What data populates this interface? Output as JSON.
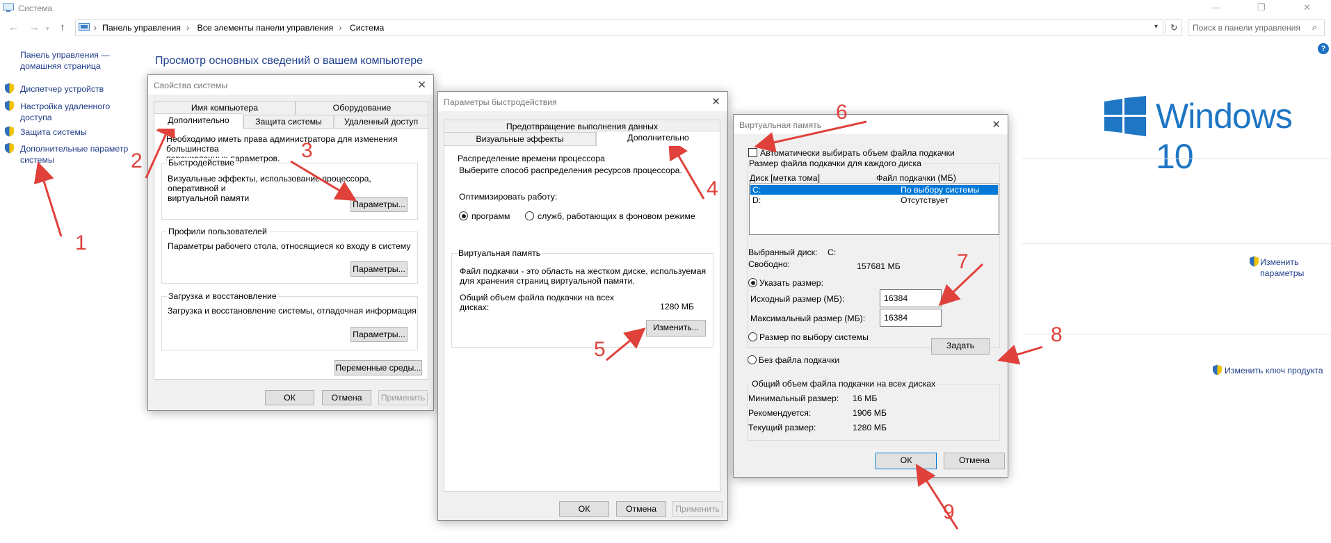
{
  "window": {
    "title": "Система",
    "minimize_glyph": "—",
    "restore_glyph": "❐",
    "close_glyph": "✕",
    "address": [
      "Панель управления",
      "Все элементы панели управления",
      "Система"
    ],
    "search_placeholder": "Поиск в панели управления"
  },
  "sidebar": {
    "home_line1": "Панель управления —",
    "home_line2": "домашняя страница",
    "items": [
      {
        "l1": "Диспетчер устройств",
        "l2": ""
      },
      {
        "l1": "Настройка удаленного",
        "l2": "доступа"
      },
      {
        "l1": "Защита системы",
        "l2": ""
      },
      {
        "l1": "Дополнительные параметр",
        "l2": "системы"
      }
    ]
  },
  "main": {
    "heading": "Просмотр основных сведений о вашем компьютере",
    "windows_logo_text": "Windows 10",
    "change_params_l1": "Изменить",
    "change_params_l2": "параметры",
    "change_key": "Изменить ключ продукта",
    "help_glyph": "?"
  },
  "sysprops": {
    "title": "Свойства системы",
    "tabs_row1": [
      "Имя компьютера",
      "Оборудование"
    ],
    "tabs_row2": [
      "Дополнительно",
      "Защита системы",
      "Удаленный доступ"
    ],
    "admin_note_l1": "Необходимо иметь права администратора для изменения большинства",
    "admin_note_l2": "перечисленных параметров.",
    "perf_label": "Быстродействие",
    "perf_desc_l1": "Визуальные эффекты, использование процессора, оперативной и",
    "perf_desc_l2": "виртуальной памяти",
    "profiles_label": "Профили пользователей",
    "profiles_desc": "Параметры рабочего стола, относящиеся ко входу в систему",
    "startup_label": "Загрузка и восстановление",
    "startup_desc": "Загрузка и восстановление системы, отладочная информация",
    "params_btn": "Параметры...",
    "env_btn": "Переменные среды...",
    "ok": "ОК",
    "cancel": "Отмена",
    "apply": "Применить"
  },
  "perfopts": {
    "title": "Параметры быстродействия",
    "tab_top": "Предотвращение выполнения данных",
    "tabs_row2": [
      "Визуальные эффекты",
      "Дополнительно"
    ],
    "cpu_label": "Распределение времени процессора",
    "cpu_desc": "Выберите способ распределения ресурсов процессора.",
    "optimize_label": "Оптимизировать работу:",
    "radio_programs": "программ",
    "radio_services": "служб, работающих в фоновом режиме",
    "vm_label": "Виртуальная память",
    "vm_desc_l1": "Файл подкачки - это область на жестком диске, используемая",
    "vm_desc_l2": "для хранения страниц виртуальной памяти.",
    "total_l1": "Общий объем файла подкачки на всех",
    "total_l2": "дисках:",
    "total_value": "1280 МБ",
    "change_btn": "Изменить...",
    "ok": "ОК",
    "cancel": "Отмена",
    "apply": "Применить"
  },
  "virtmem": {
    "title": "Виртуальная память",
    "auto_checkbox": "Автоматически выбирать объем файла подкачки",
    "per_disk_label": "Размер файла подкачки для каждого диска",
    "col_disk": "Диск [метка тома]",
    "col_file": "Файл подкачки (МБ)",
    "rows": [
      {
        "disk": "C:",
        "file": "По выбору системы"
      },
      {
        "disk": "D:",
        "file": "Отсутствует"
      }
    ],
    "selected_disk_label": "Выбранный диск:",
    "selected_disk_value": "C:",
    "free_label": "Свободно:",
    "free_value": "157681 МБ",
    "custom_radio": "Указать размер:",
    "initial_label": "Исходный размер (МБ):",
    "initial_value": "16384",
    "max_label": "Максимальный размер (МБ):",
    "max_value": "16384",
    "system_radio": "Размер по выбору системы",
    "none_radio": "Без файла подкачки",
    "set_btn": "Задать",
    "total_label": "Общий объем файла подкачки на всех дисках",
    "min_label": "Минимальный размер:",
    "min_value": "16 МБ",
    "rec_label": "Рекомендуется:",
    "rec_value": "1906 МБ",
    "cur_label": "Текущий размер:",
    "cur_value": "1280 МБ",
    "ok": "ОК",
    "cancel": "Отмена"
  },
  "annotations": [
    "1",
    "2",
    "3",
    "4",
    "5",
    "6",
    "7",
    "8",
    "9"
  ],
  "colors": {
    "annotation": "#e0413b",
    "link": "#1f3c88",
    "accent": "#0078d7",
    "windows_blue": "#1e76c4"
  }
}
